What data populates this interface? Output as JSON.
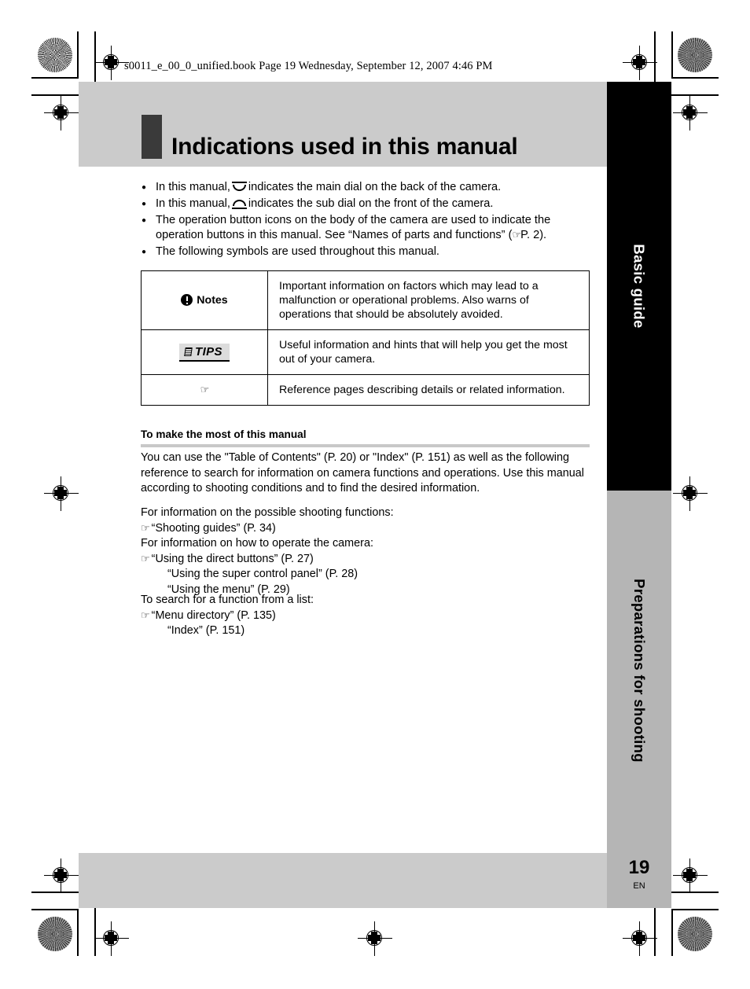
{
  "file_header": "s0011_e_00_0_unified.book  Page 19  Wednesday, September 12, 2007  4:46 PM",
  "page_title": "Indications used in this manual",
  "bullets": [
    {
      "before_icon": "In this manual,",
      "icon": "main-dial-icon",
      "after_icon": "indicates the main dial on the back of the camera."
    },
    {
      "before_icon": "In this manual,",
      "icon": "sub-dial-icon",
      "after_icon": "indicates the sub dial on the front of the camera."
    },
    {
      "text_part1": "The operation button icons on the body of the camera are used to indicate the operation buttons in this manual. See “Names of parts and functions” (",
      "icon": "reference-hand-icon",
      "text_part2": "P. 2)."
    },
    {
      "text": "The following symbols are used throughout this manual."
    }
  ],
  "symbols_table": {
    "rows": [
      {
        "label": "Notes",
        "label_icon": "exclamation-circle-icon",
        "description": "Important information on factors which may lead to a malfunction or operational problems. Also warns of operations that should be absolutely avoided."
      },
      {
        "label": "TIPS",
        "label_icon": "tips-document-icon",
        "description": "Useful information and hints that will help you get the most out of your camera."
      },
      {
        "label": "",
        "label_icon": "reference-hand-icon",
        "description": "Reference pages describing details or related information."
      }
    ]
  },
  "section": {
    "heading": "To make the most of this manual",
    "paragraph": "You can use the \"Table of Contents\" (P. 20) or \"Index\" (P. 151) as well as the following reference to search for information on camera functions and operations. Use this manual according to shooting conditions and to find the desired information."
  },
  "reference_groups": [
    {
      "lead": "For information on the possible shooting functions:",
      "entries": [
        {
          "text": "“Shooting guides” (P. 34)",
          "has_icon": true
        }
      ]
    },
    {
      "lead": "For information on how to operate the camera:",
      "entries": [
        {
          "text": "“Using the direct buttons” (P. 27)",
          "has_icon": true
        },
        {
          "text": "“Using the super control panel” (P. 28)",
          "has_icon": false
        },
        {
          "text": "“Using the menu” (P. 29)",
          "has_icon": false
        }
      ]
    },
    {
      "lead": "To search for a function from a list:",
      "entries": [
        {
          "text": "“Menu directory” (P. 135)",
          "has_icon": true
        },
        {
          "text": "“Index” (P. 151)",
          "has_icon": false
        }
      ]
    }
  ],
  "side_tabs": [
    {
      "label": "Basic guide",
      "background": "#000000",
      "color": "#ffffff"
    },
    {
      "label": "Preparations for shooting",
      "background": "#b5b5b5",
      "color": "#000000"
    }
  ],
  "page_footer": {
    "number": "19",
    "language": "EN"
  },
  "colors": {
    "title_band": "#cbcbcb",
    "title_mark": "#3a3a3a",
    "tab_black": "#000000",
    "tab_gray": "#b5b5b5",
    "section_rule": "#c8c8c8"
  }
}
